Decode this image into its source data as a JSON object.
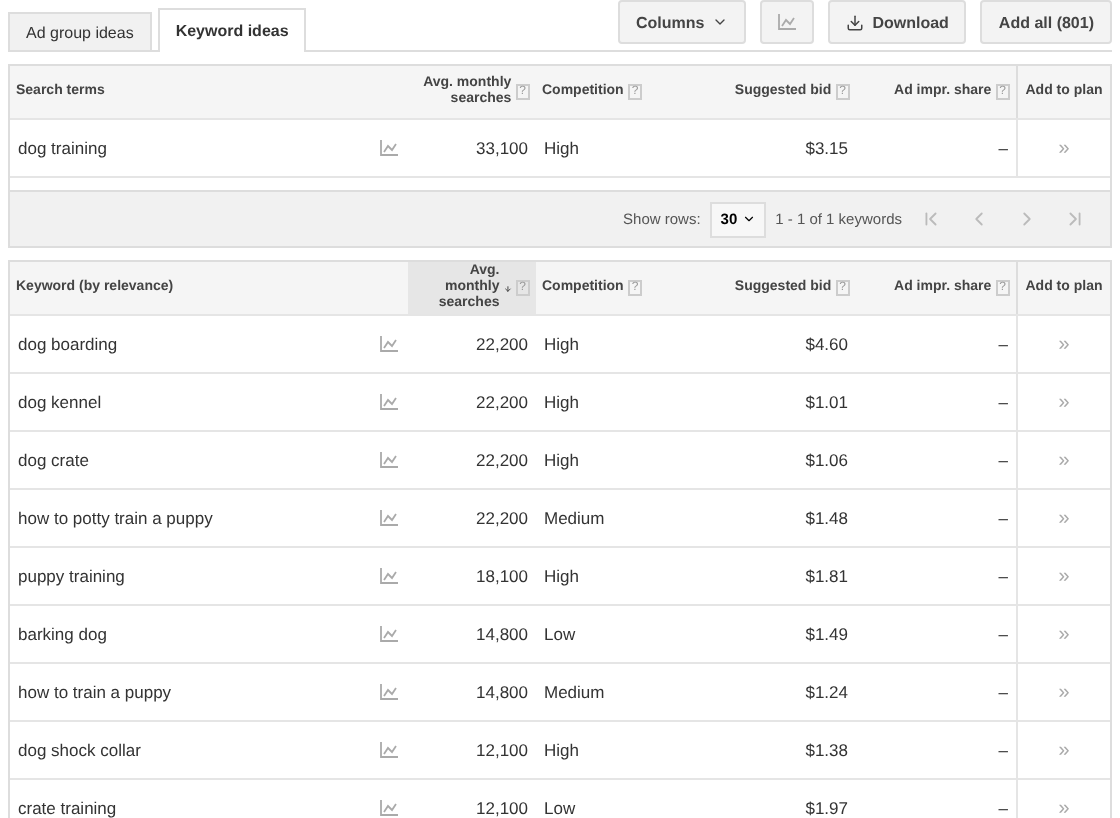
{
  "tabs": [
    {
      "label": "Ad group ideas",
      "selected": false
    },
    {
      "label": "Keyword ideas",
      "selected": true
    }
  ],
  "toolbar": {
    "columns": "Columns",
    "download": "Download",
    "add_all": "Add all (801)"
  },
  "search_terms_table": {
    "columns": [
      {
        "label": "Search terms"
      },
      {},
      {
        "label": "Avg. monthly searches",
        "help": "?"
      },
      {
        "label": "Competition",
        "help": "?"
      },
      {
        "label": "Suggested bid",
        "help": "?"
      },
      {
        "label": "Ad impr. share",
        "help": "?"
      },
      {
        "label": "Add to plan"
      }
    ],
    "rows": [
      {
        "keyword": "dog training",
        "searches": "33,100",
        "competition": "High",
        "bid": "$3.15",
        "impr_share": "–",
        "add": "»"
      }
    ]
  },
  "pager": {
    "label": "Show rows:",
    "rows_per_page": "30",
    "range": "1 - 1 of 1 keywords"
  },
  "keyword_table": {
    "columns": [
      {
        "label": "Keyword (by relevance)",
        "sorted": false
      },
      {},
      {
        "label": "Avg. monthly searches",
        "help": "?",
        "sorted": true
      },
      {
        "label": "Competition",
        "help": "?",
        "sorted": false
      },
      {
        "label": "Suggested bid",
        "help": "?",
        "sorted": false
      },
      {
        "label": "Ad impr. share",
        "help": "?",
        "sorted": false
      },
      {
        "label": "Add to plan",
        "sorted": false
      }
    ],
    "rows": [
      {
        "keyword": "dog boarding",
        "searches": "22,200",
        "competition": "High",
        "bid": "$4.60",
        "impr_share": "–",
        "add": "»"
      },
      {
        "keyword": "dog kennel",
        "searches": "22,200",
        "competition": "High",
        "bid": "$1.01",
        "impr_share": "–",
        "add": "»"
      },
      {
        "keyword": "dog crate",
        "searches": "22,200",
        "competition": "High",
        "bid": "$1.06",
        "impr_share": "–",
        "add": "»"
      },
      {
        "keyword": "how to potty train a puppy",
        "searches": "22,200",
        "competition": "Medium",
        "bid": "$1.48",
        "impr_share": "–",
        "add": "»"
      },
      {
        "keyword": "puppy training",
        "searches": "18,100",
        "competition": "High",
        "bid": "$1.81",
        "impr_share": "–",
        "add": "»"
      },
      {
        "keyword": "barking dog",
        "searches": "14,800",
        "competition": "Low",
        "bid": "$1.49",
        "impr_share": "–",
        "add": "»"
      },
      {
        "keyword": "how to train a puppy",
        "searches": "14,800",
        "competition": "Medium",
        "bid": "$1.24",
        "impr_share": "–",
        "add": "»"
      },
      {
        "keyword": "dog shock collar",
        "searches": "12,100",
        "competition": "High",
        "bid": "$1.38",
        "impr_share": "–",
        "add": "»"
      },
      {
        "keyword": "crate training",
        "searches": "12,100",
        "competition": "Low",
        "bid": "$1.97",
        "impr_share": "–",
        "add": "»"
      }
    ]
  }
}
